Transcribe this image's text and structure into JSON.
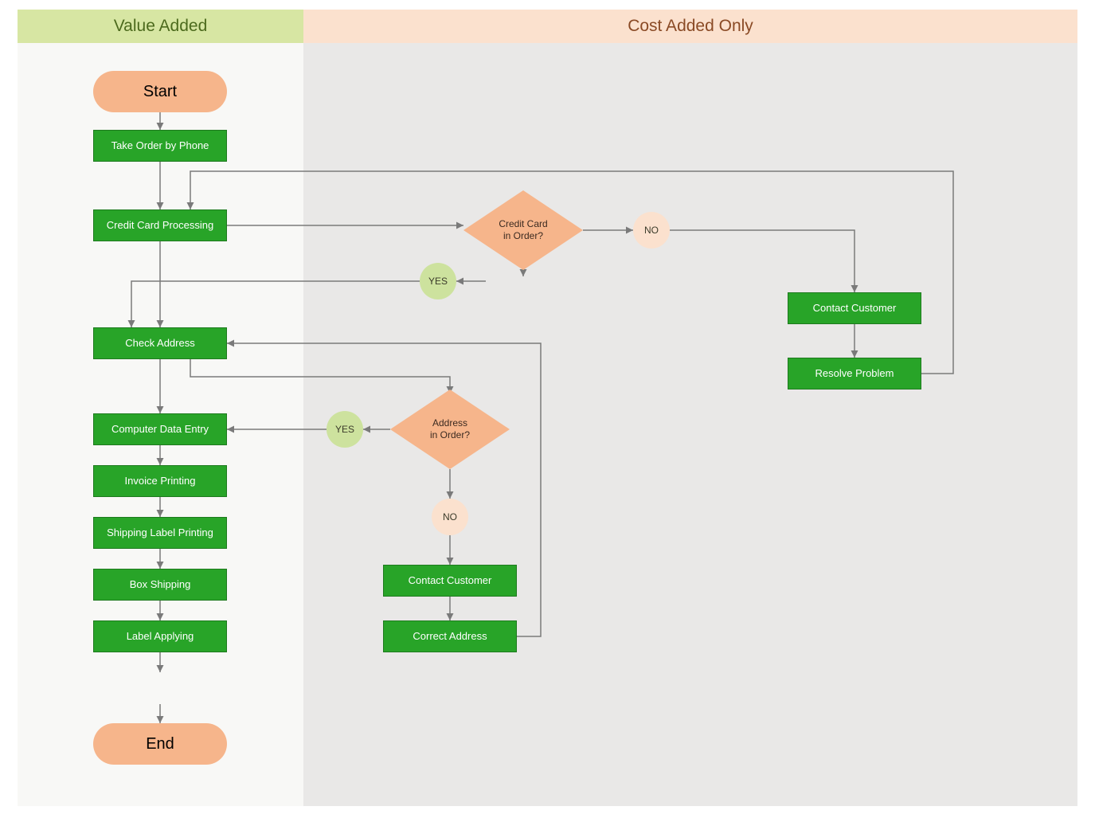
{
  "lanes": {
    "left": "Value Added",
    "right": "Cost Added Only"
  },
  "start": "Start",
  "end": "End",
  "proc": {
    "take_order": "Take Order by Phone",
    "cc_proc": "Credit Card Processing",
    "check_addr": "Check Address",
    "data_entry": "Computer Data Entry",
    "invoice": "Invoice Printing",
    "ship_label": "Shipping Label Printing",
    "box_ship": "Box Shipping",
    "label_apply": "Label Applying",
    "contact1": "Contact Customer",
    "resolve": "Resolve Problem",
    "contact2": "Contact Customer",
    "correct_addr": "Correct Address"
  },
  "decision": {
    "cc": {
      "l1": "Credit Card",
      "l2": "in Order?"
    },
    "addr": {
      "l1": "Address",
      "l2": "in Order?"
    }
  },
  "yes": "YES",
  "no": "NO"
}
